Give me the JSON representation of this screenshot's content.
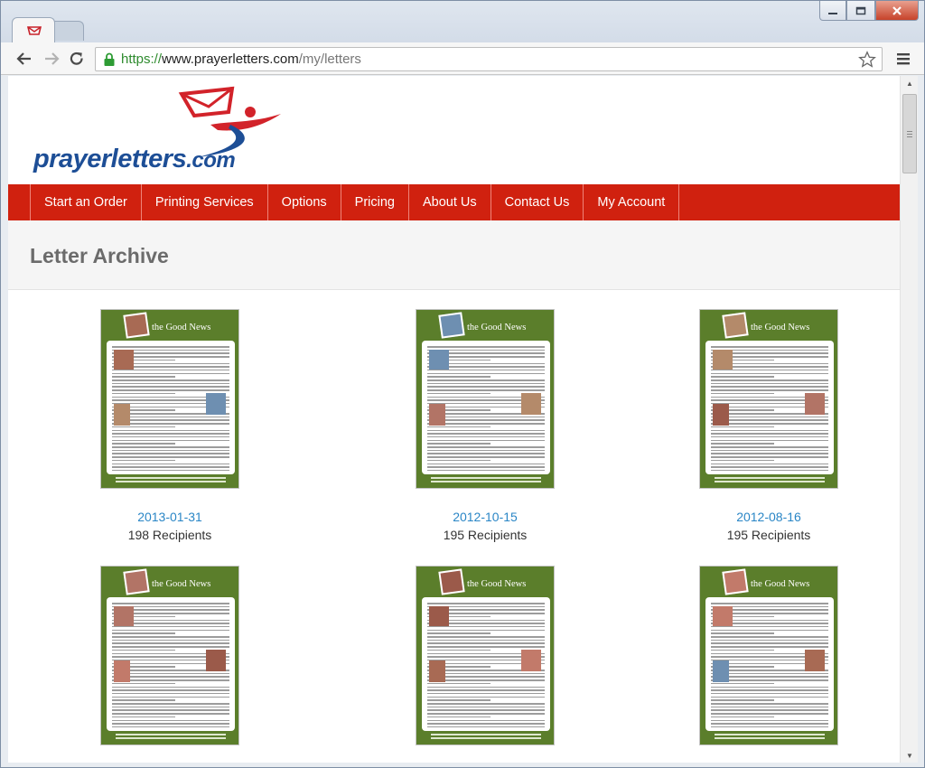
{
  "browser": {
    "url_scheme": "https://",
    "url_host": "www.prayerletters.com",
    "url_path": "/my/letters"
  },
  "site": {
    "logo": {
      "prayer": "prayer",
      "letters": "letters",
      "com": ".com"
    },
    "nav": [
      "Start an Order",
      "Printing Services",
      "Options",
      "Pricing",
      "About Us",
      "Contact Us",
      "My Account"
    ],
    "page_title": "Letter Archive"
  },
  "letters": [
    {
      "title": "the Good News",
      "date": "2013-01-31",
      "recipients": "198 Recipients"
    },
    {
      "title": "the Good News",
      "date": "2012-10-15",
      "recipients": "195 Recipients"
    },
    {
      "title": "the Good News",
      "date": "2012-08-16",
      "recipients": "195 Recipients"
    },
    {
      "title": "the Good News",
      "date": "",
      "recipients": ""
    },
    {
      "title": "the Good News",
      "date": "",
      "recipients": ""
    },
    {
      "title": "the Good News",
      "date": "",
      "recipients": ""
    }
  ],
  "colors": {
    "nav_red": "#d0210f",
    "link_blue": "#2a86c6",
    "newsletter_green": "#5b7e2b",
    "logo_blue": "#1d4e96"
  }
}
